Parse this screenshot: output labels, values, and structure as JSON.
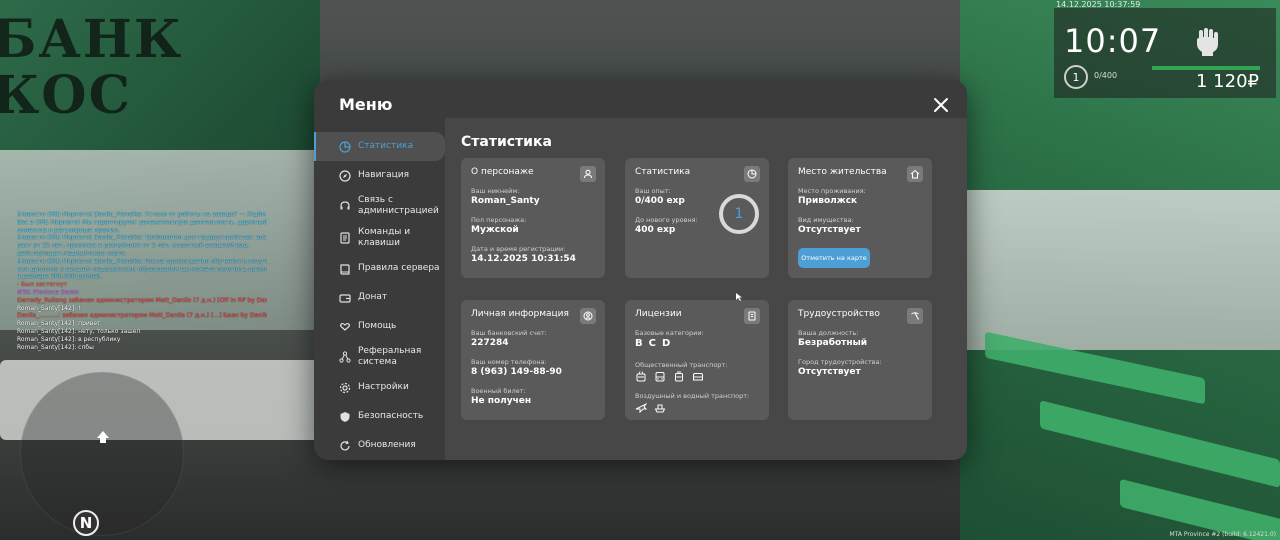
{
  "background": {
    "bank_sign": "БАНК\nКОС"
  },
  "hud": {
    "date": "14.12.2025 10:37:59",
    "time": "10:07",
    "level": "1",
    "exp": "0/400",
    "money": "1 120₽",
    "icons": [
      "fist-icon"
    ]
  },
  "chat": {
    "lines": [
      {
        "text": "[Новости ОКБ Мирного] Danila_Flanelka: Устали от работы на заводе? — Ждём",
        "color": "#5fd8ff"
      },
      {
        "text": " Вас в ОКБ Мирного! Мы гарантируем: увлекательную деятельность, дружный к",
        "color": "#5fd8ff"
      },
      {
        "text": "оллектив и регулярные премии.",
        "color": "#5fd8ff"
      },
      {
        "text": "[Новости ОКБ Мирного] Danila_Flanelka: Требования для трудоустройства: воз",
        "color": "#5fd8ff"
      },
      {
        "text": "раст от 25 лет, прописка в республике от 5 лет, опрятный внешний вид,",
        "color": "#5fd8ff"
      },
      {
        "text": " действующая медицинская карта.",
        "color": "#5fd8ff"
      },
      {
        "text": "[Новости ОКБ Мирного] Danila_Flanelka: После прохождения обучения и получе",
        "color": "#5fd8ff"
      },
      {
        "text": "ния диплома о высшем медицинском образовании вы можете получить премию",
        "color": "#5fd8ff"
      },
      {
        "text": " в размере 300.000 рублей.",
        "color": "#5fd8ff"
      },
      {
        "text": "- Был застегнут",
        "color": "#ff5555"
      },
      {
        "text": "MTA: Province Demo",
        "color": "#d66bff"
      },
      {
        "text": "Gerrady_Ruliong забанен администратором Matt_Danilo (7 д.н.) [Off in RP by Danila]",
        "color": "#ff4444"
      },
      {
        "text": "Roman_Santy[142]: !",
        "color": "#ffffff"
      },
      {
        "text": "Danila_..........: забанен администратором Matt_Danilo (7 д.н.) [...] Баан by Danila]",
        "color": "#ff4444"
      },
      {
        "text": "Roman_Santy[142]: привет",
        "color": "#ffffff"
      },
      {
        "text": "Roman_Santy[142]: нету, только зашел",
        "color": "#ffffff"
      },
      {
        "text": "Roman_Santy[142]: в республику",
        "color": "#ffffff"
      },
      {
        "text": "Roman_Santy[142]: спбы",
        "color": "#ffffff"
      }
    ]
  },
  "minimap": {
    "north_label": "N"
  },
  "footer": {
    "build": "MTA Province #2 (build: 6.12421.0)"
  },
  "menu": {
    "title": "Меню",
    "sidebar": [
      {
        "label": "Статистика",
        "icon": "pie-chart-icon",
        "active": true
      },
      {
        "label": "Навигация",
        "icon": "compass-icon"
      },
      {
        "label": "Связь с администрацией",
        "icon": "headset-icon"
      },
      {
        "label": "Команды и клавиши",
        "icon": "document-icon"
      },
      {
        "label": "Правила сервера",
        "icon": "book-icon"
      },
      {
        "label": "Донат",
        "icon": "wallet-icon"
      },
      {
        "label": "Помощь",
        "icon": "heart-hand-icon"
      },
      {
        "label": "Реферальная система",
        "icon": "network-icon"
      },
      {
        "label": "Настройки",
        "icon": "gear-icon"
      },
      {
        "label": "Безопасность",
        "icon": "shield-icon"
      },
      {
        "label": "Обновления",
        "icon": "refresh-icon"
      }
    ],
    "content_title": "Статистика",
    "cards": {
      "character": {
        "title": "О персонаже",
        "nick_label": "Ваш никнейм:",
        "nick": "Roman_Santy",
        "gender_label": "Пол персонажа:",
        "gender": "Мужской",
        "reg_label": "Дата и время регистрации:",
        "reg": "14.12.2025 10:31:54"
      },
      "stats": {
        "title": "Статистика",
        "exp_label": "Ваш опыт:",
        "exp": "0/400 exp",
        "next_label": "До нового уровня:",
        "next": "400 exp",
        "level": "1"
      },
      "residence": {
        "title": "Место жительства",
        "place_label": "Место проживания:",
        "place": "Приволжск",
        "property_label": "Вид имущества:",
        "property": "Отсутствует",
        "map_button": "Отметить на карте"
      },
      "personal": {
        "title": "Личная информация",
        "bank_label": "Ваш банковский счет:",
        "bank": "227284",
        "phone_label": "Ваш номер телефона:",
        "phone": "8 (963) 149-88-90",
        "military_label": "Военный билет:",
        "military": "Не получен"
      },
      "licenses": {
        "title": "Лицензии",
        "basic_label": "Базовые категории:",
        "basic": [
          "B",
          "C",
          "D"
        ],
        "public_label": "Общественный транспорт:",
        "public_icons": [
          "trolleybus-icon",
          "bus-icon",
          "tram-icon",
          "minibus-icon"
        ],
        "air_label": "Воздушный и водный транспорт:",
        "air_icons": [
          "plane-icon",
          "boat-icon"
        ]
      },
      "employment": {
        "title": "Трудоустройство",
        "position_label": "Ваша должность:",
        "position": "Безработный",
        "city_label": "Город трудоустройства:",
        "city": "Отсутствует"
      }
    }
  },
  "colors": {
    "accent": "#4d9fd6",
    "window": "#3b3b3b",
    "content": "#474747",
    "card": "#5a5a5a",
    "hud_bar": "#33a552"
  }
}
